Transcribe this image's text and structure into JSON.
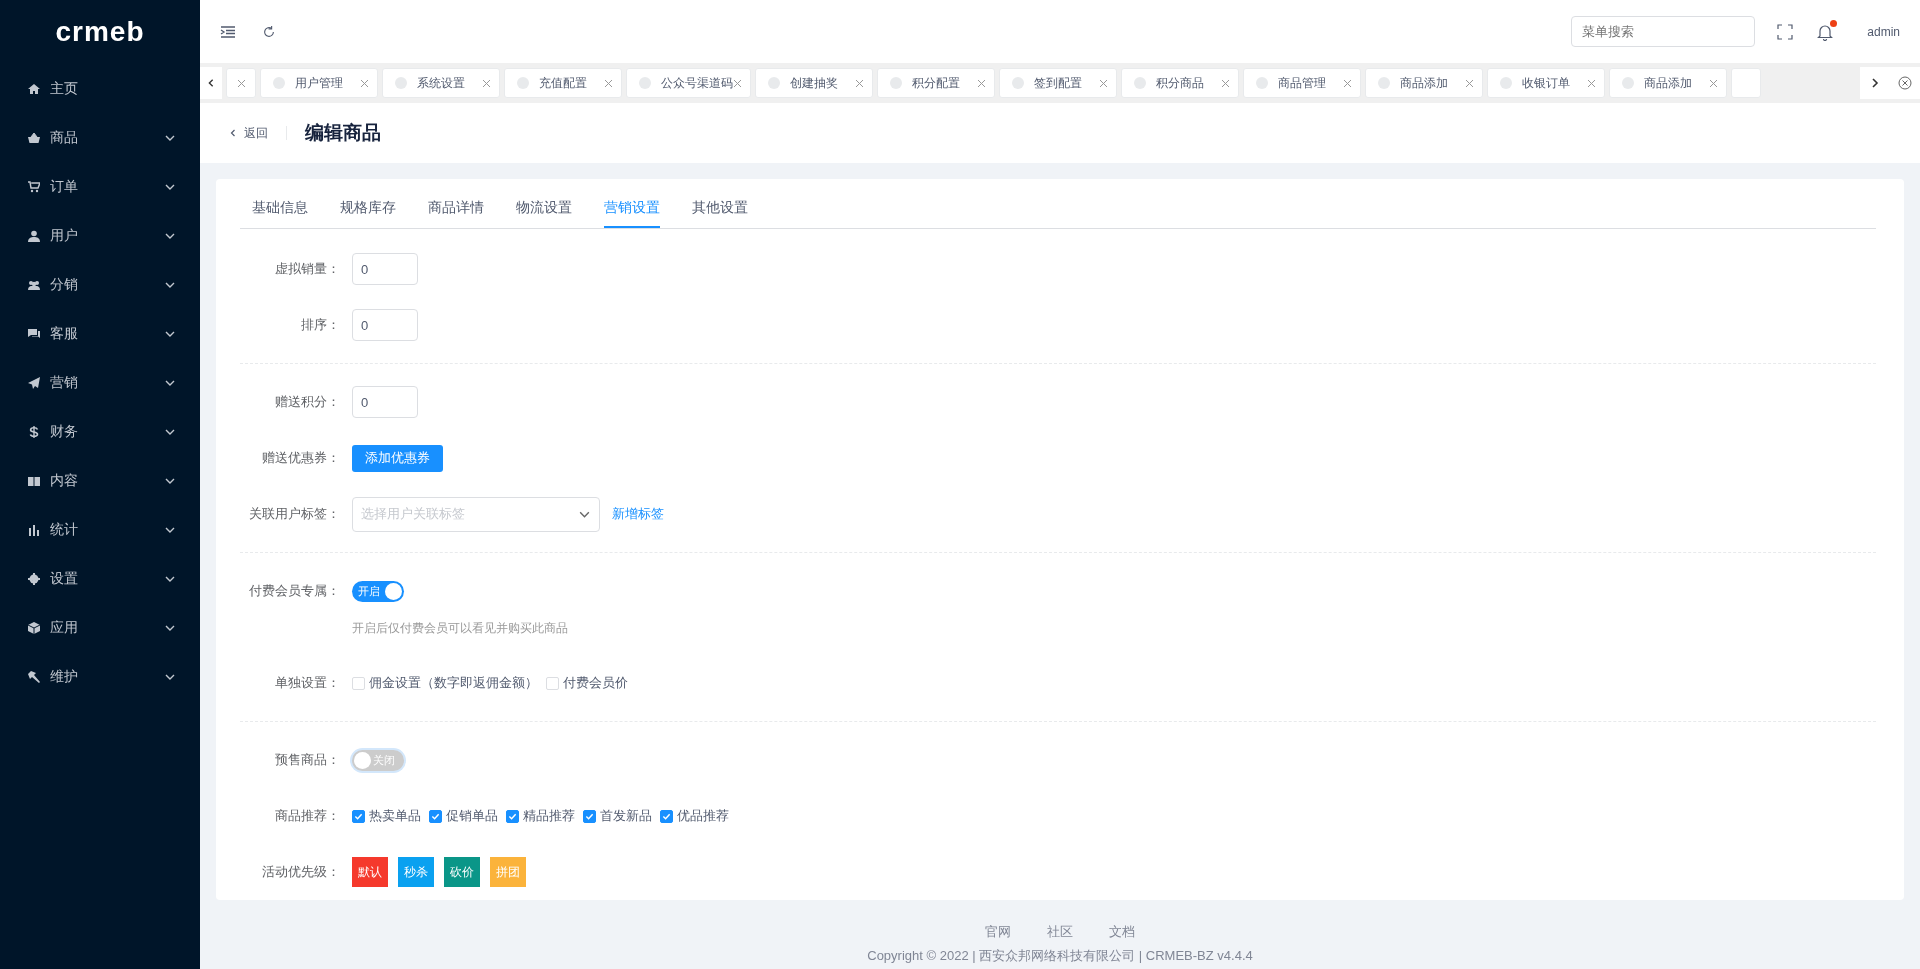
{
  "sidebar": {
    "logo": "crmeb",
    "items": [
      {
        "label": "主页",
        "expandable": false
      },
      {
        "label": "商品",
        "expandable": true
      },
      {
        "label": "订单",
        "expandable": true
      },
      {
        "label": "用户",
        "expandable": true
      },
      {
        "label": "分销",
        "expandable": true
      },
      {
        "label": "客服",
        "expandable": true
      },
      {
        "label": "营销",
        "expandable": true
      },
      {
        "label": "财务",
        "expandable": true
      },
      {
        "label": "内容",
        "expandable": true
      },
      {
        "label": "统计",
        "expandable": true
      },
      {
        "label": "设置",
        "expandable": true
      },
      {
        "label": "应用",
        "expandable": true
      },
      {
        "label": "维护",
        "expandable": true
      }
    ]
  },
  "header": {
    "search": {
      "placeholder": "菜单搜索"
    },
    "notification": true,
    "user": "admin"
  },
  "page_tabs": [
    {
      "kind": "partial"
    },
    {
      "kind": "full",
      "label": "用户管理"
    },
    {
      "kind": "full",
      "label": "系统设置"
    },
    {
      "kind": "full",
      "label": "充值配置"
    },
    {
      "kind": "full",
      "label": "公众号渠道码"
    },
    {
      "kind": "full",
      "label": "创建抽奖"
    },
    {
      "kind": "full",
      "label": "积分配置"
    },
    {
      "kind": "full",
      "label": "签到配置"
    },
    {
      "kind": "full",
      "label": "积分商品"
    },
    {
      "kind": "full",
      "label": "商品管理"
    },
    {
      "kind": "full",
      "label": "商品添加"
    },
    {
      "kind": "full",
      "label": "收银订单"
    },
    {
      "kind": "full",
      "label": "商品添加"
    },
    {
      "kind": "partial"
    }
  ],
  "page_header": {
    "back": "返回",
    "title": "编辑商品"
  },
  "form_tabs": [
    {
      "label": "基础信息",
      "selected": false
    },
    {
      "label": "规格库存",
      "selected": false
    },
    {
      "label": "商品详情",
      "selected": false
    },
    {
      "label": "物流设置",
      "selected": false
    },
    {
      "label": "营销设置",
      "selected": true
    },
    {
      "label": "其他设置",
      "selected": false
    }
  ],
  "sections": [
    {
      "rows": [
        {
          "kind": "input",
          "label": "虚拟销量：",
          "value": "0"
        },
        {
          "kind": "input",
          "label": "排序：",
          "value": "0"
        }
      ]
    },
    {
      "rows": [
        {
          "kind": "input",
          "label": "赠送积分：",
          "value": "0"
        },
        {
          "kind": "button",
          "label": "赠送优惠券：",
          "button": "添加优惠券"
        },
        {
          "kind": "select",
          "label": "关联用户标签：",
          "placeholder": "选择用户关联标签",
          "link": "新增标签"
        }
      ]
    },
    {
      "rows": [
        {
          "kind": "switch",
          "label": "付费会员专属：",
          "on": true,
          "text": "开启",
          "hint": "开启后仅付费会员可以看见并购买此商品"
        },
        {
          "kind": "checkboxes",
          "label": "单独设置：",
          "options": [
            {
              "label": "佣金设置（数字即返佣金额）",
              "checked": false
            },
            {
              "label": "付费会员价",
              "checked": false
            }
          ]
        }
      ]
    },
    {
      "rows": [
        {
          "kind": "switch",
          "label": "预售商品：",
          "on": false,
          "text": "关闭"
        },
        {
          "kind": "checkboxes",
          "label": "商品推荐：",
          "options": [
            {
              "label": "热卖单品",
              "checked": true
            },
            {
              "label": "促销单品",
              "checked": true
            },
            {
              "label": "精品推荐",
              "checked": true
            },
            {
              "label": "首发新品",
              "checked": true
            },
            {
              "label": "优品推荐",
              "checked": true
            }
          ]
        },
        {
          "kind": "tags",
          "label": "活动优先级：",
          "items": [
            {
              "label": "默认",
              "color": "#f5392c"
            },
            {
              "label": "秒杀",
              "color": "#0aa1f0"
            },
            {
              "label": "砍价",
              "color": "#0a9688"
            },
            {
              "label": "拼团",
              "color": "#fbb33b"
            }
          ]
        }
      ]
    }
  ],
  "footer": {
    "links": [
      "官网",
      "社区",
      "文档"
    ],
    "copyright": "Copyright © 2022 | 西安众邦网络科技有限公司 | CRMEB-BZ v4.4.4"
  }
}
